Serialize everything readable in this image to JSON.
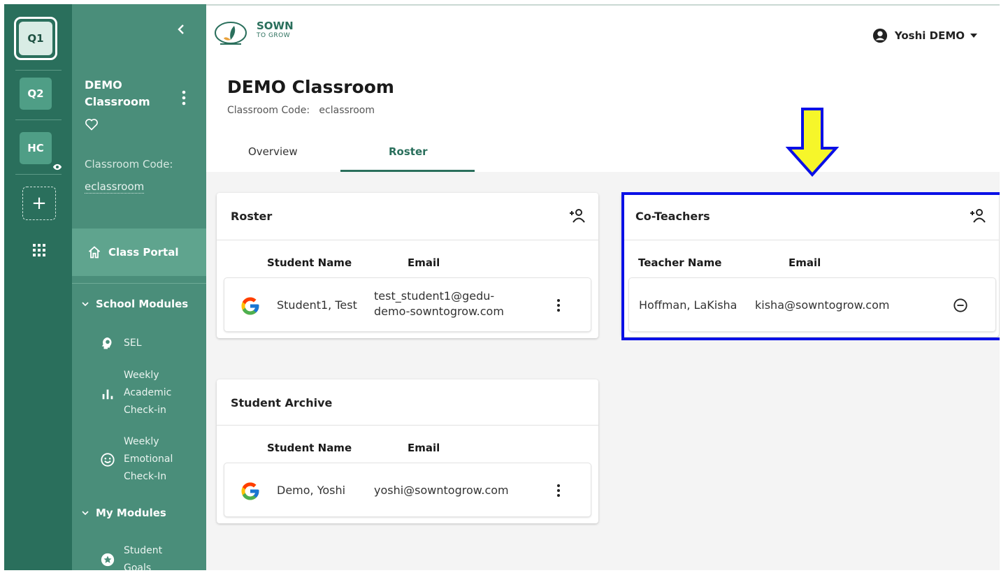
{
  "rail": {
    "items": [
      {
        "label": "Q1",
        "active": true
      },
      {
        "label": "Q2"
      },
      {
        "label": "HC"
      }
    ],
    "add_label": "+"
  },
  "sidebar": {
    "classroom_name": "DEMO Classroom",
    "classroom_code_label": "Classroom Code:",
    "classroom_code": "eclassroom",
    "class_portal": "Class Portal",
    "school_modules_title": "School Modules",
    "school_modules": [
      {
        "label": "SEL",
        "icon": "brain-icon"
      },
      {
        "label": "Weekly Academic Check-in",
        "lines": [
          "Weekly",
          "Academic",
          "Check-in"
        ],
        "icon": "bar-chart-icon"
      },
      {
        "label": "Weekly Emotional Check-In",
        "lines": [
          "Weekly",
          "Emotional",
          "Check-In"
        ],
        "icon": "smiley-icon"
      }
    ],
    "my_modules_title": "My Modules",
    "my_modules": [
      {
        "label": "Student Goals",
        "lines": [
          "Student",
          "Goals"
        ],
        "icon": "star-circle-icon"
      }
    ]
  },
  "header": {
    "logo_line1": "SOWN",
    "logo_line2": "TO GROW",
    "user_name": "Yoshi DEMO"
  },
  "page": {
    "title": "DEMO Classroom",
    "code_label": "Classroom Code:",
    "code_value": "eclassroom",
    "tabs": [
      {
        "label": "Overview",
        "active": false
      },
      {
        "label": "Roster",
        "active": true
      }
    ]
  },
  "roster": {
    "title": "Roster",
    "col_name": "Student Name",
    "col_email": "Email",
    "rows": [
      {
        "name": "Student1, Test",
        "email_line1": "test_student1@gedu-",
        "email_line2": "demo-sowntogrow.com"
      }
    ]
  },
  "archive": {
    "title": "Student Archive",
    "col_name": "Student Name",
    "col_email": "Email",
    "rows": [
      {
        "name": "Demo, Yoshi",
        "email": "yoshi@sowntogrow.com"
      }
    ]
  },
  "coteachers": {
    "title": "Co-Teachers",
    "col_name": "Teacher Name",
    "col_email": "Email",
    "rows": [
      {
        "name": "Hoffman, LaKisha",
        "email": "kisha@sowntogrow.com"
      }
    ]
  },
  "colors": {
    "rail": "#2a6f5c",
    "sidebar": "#4a8e7a",
    "accent": "#2a6f5c",
    "annotation_box": "#0a10e6",
    "annotation_arrow": "#f6f62a"
  }
}
